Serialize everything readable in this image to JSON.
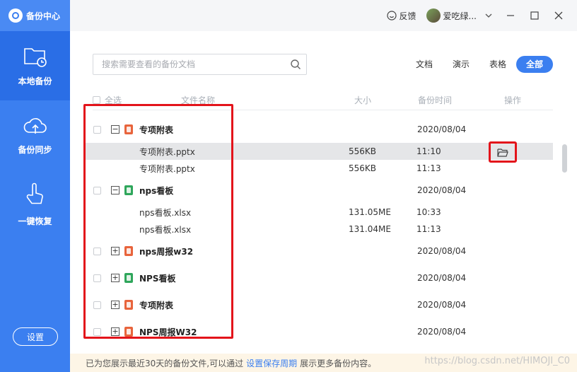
{
  "app": {
    "title": "备份中心"
  },
  "sidebar": {
    "items": [
      {
        "label": "本地备份",
        "icon": "folder-clock-icon",
        "active": true
      },
      {
        "label": "备份同步",
        "icon": "cloud-upload-icon",
        "active": false
      },
      {
        "label": "一键恢复",
        "icon": "hand-pointer-icon",
        "active": false
      }
    ],
    "settings_label": "设置"
  },
  "titlebar": {
    "feedback_label": "反馈",
    "user_name": "爱吃绿..."
  },
  "search": {
    "placeholder": "搜索需要查看的备份文档"
  },
  "filters": [
    {
      "label": "文档",
      "active": false
    },
    {
      "label": "演示",
      "active": false
    },
    {
      "label": "表格",
      "active": false
    },
    {
      "label": "全部",
      "active": true
    }
  ],
  "table": {
    "headers": {
      "select_all": "全选",
      "name": "文件名称",
      "size": "大小",
      "time": "备份时间",
      "ops": "操作"
    },
    "groups": [
      {
        "name": "专项附表",
        "type": "ppt",
        "expanded": true,
        "date": "2020/08/04",
        "files": [
          {
            "name": "专项附表.pptx",
            "size": "556KB",
            "time": "11:10",
            "highlight": true
          },
          {
            "name": "专项附表.pptx",
            "size": "556KB",
            "time": "11:13",
            "highlight": false
          }
        ]
      },
      {
        "name": "nps看板",
        "type": "xls",
        "expanded": true,
        "date": "2020/08/04",
        "files": [
          {
            "name": "nps看板.xlsx",
            "size": "131.05ME",
            "time": "10:33",
            "highlight": false
          },
          {
            "name": "nps看板.xlsx",
            "size": "131.04ME",
            "time": "11:13",
            "highlight": false
          }
        ]
      },
      {
        "name": "nps周报w32",
        "type": "ppt",
        "expanded": false,
        "date": "2020/08/04",
        "files": []
      },
      {
        "name": "NPS看板",
        "type": "xls",
        "expanded": false,
        "date": "2020/08/04",
        "files": []
      },
      {
        "name": "专项附表",
        "type": "ppt",
        "expanded": false,
        "date": "2020/08/04",
        "files": []
      },
      {
        "name": "NPS周报W32",
        "type": "ppt",
        "expanded": false,
        "date": "2020/08/04",
        "files": []
      }
    ]
  },
  "footer": {
    "prefix": "已为您展示最近30天的备份文件,可以通过",
    "link": "设置保存周期",
    "suffix": "展示更多备份内容。"
  },
  "watermark": "https://blog.csdn.net/HIMOJI_C0"
}
